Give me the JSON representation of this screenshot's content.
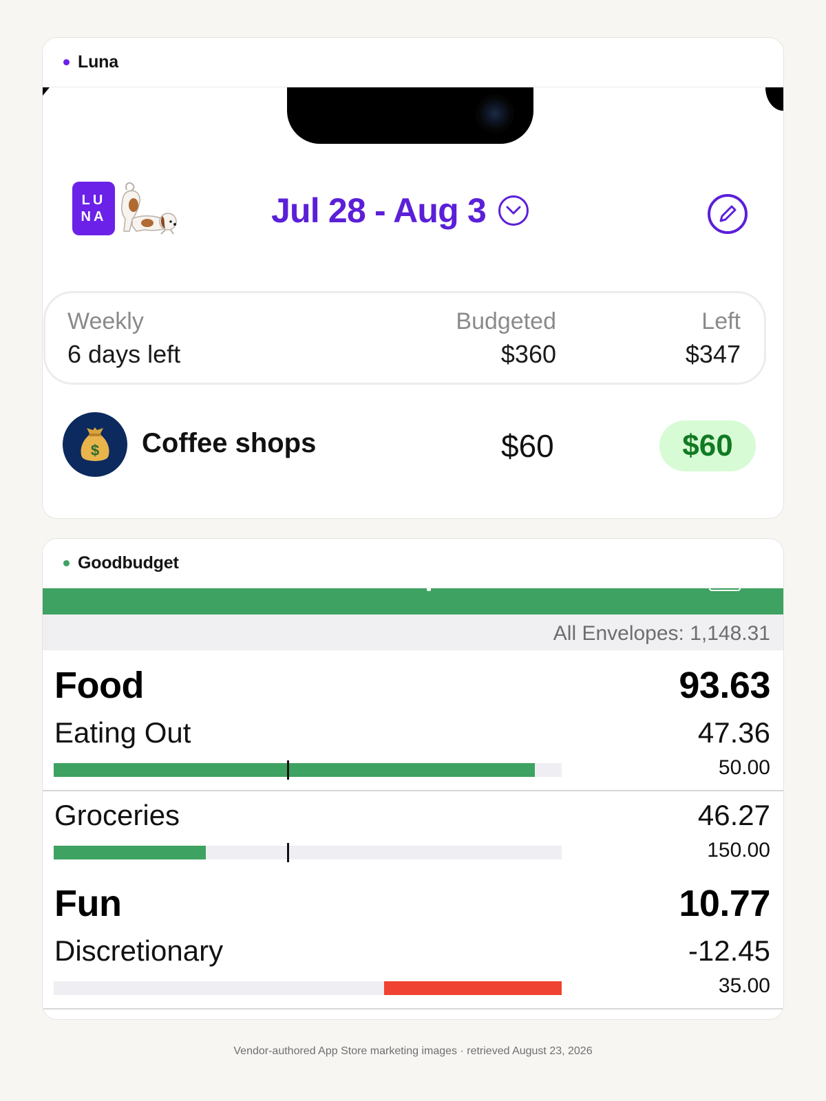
{
  "luna": {
    "card_title": "Luna",
    "dot_color": "#6b21e8",
    "logo_line1": "LU",
    "logo_line2": "NA",
    "date_range": "Jul 28 - Aug 3",
    "summary": {
      "period_label": "Weekly",
      "days_left": "6 days left",
      "budgeted_label": "Budgeted",
      "budgeted_value": "$360",
      "left_label": "Left",
      "left_value": "$347"
    },
    "category": {
      "icon": "money-bag-icon",
      "name": "Coffee shops",
      "budgeted": "$60",
      "left": "$60"
    },
    "accent_color": "#5b1fd8"
  },
  "goodbudget": {
    "card_title": "Goodbudget",
    "dot_color": "#3ea262",
    "all_envelopes": "All Envelopes: 1,148.31",
    "groups": [
      {
        "name": "Food",
        "total": "93.63",
        "envelopes": [
          {
            "name": "Eating Out",
            "balance": "47.36",
            "budget": "50.00",
            "fill_fraction": 0.947,
            "fill_color": "#3ea262",
            "marker_fraction": 0.46
          },
          {
            "name": "Groceries",
            "balance": "46.27",
            "budget": "150.00",
            "fill_fraction": 0.3,
            "fill_color": "#3ea262",
            "marker_fraction": 0.46
          }
        ]
      },
      {
        "name": "Fun",
        "total": "10.77",
        "envelopes": [
          {
            "name": "Discretionary",
            "balance": "-12.45",
            "budget": "35.00",
            "fill_fraction": 0.35,
            "fill_color": "#f04232",
            "fill_from": "right"
          }
        ]
      }
    ]
  },
  "footer": "Vendor-authored App Store marketing images · retrieved August 23, 2026"
}
